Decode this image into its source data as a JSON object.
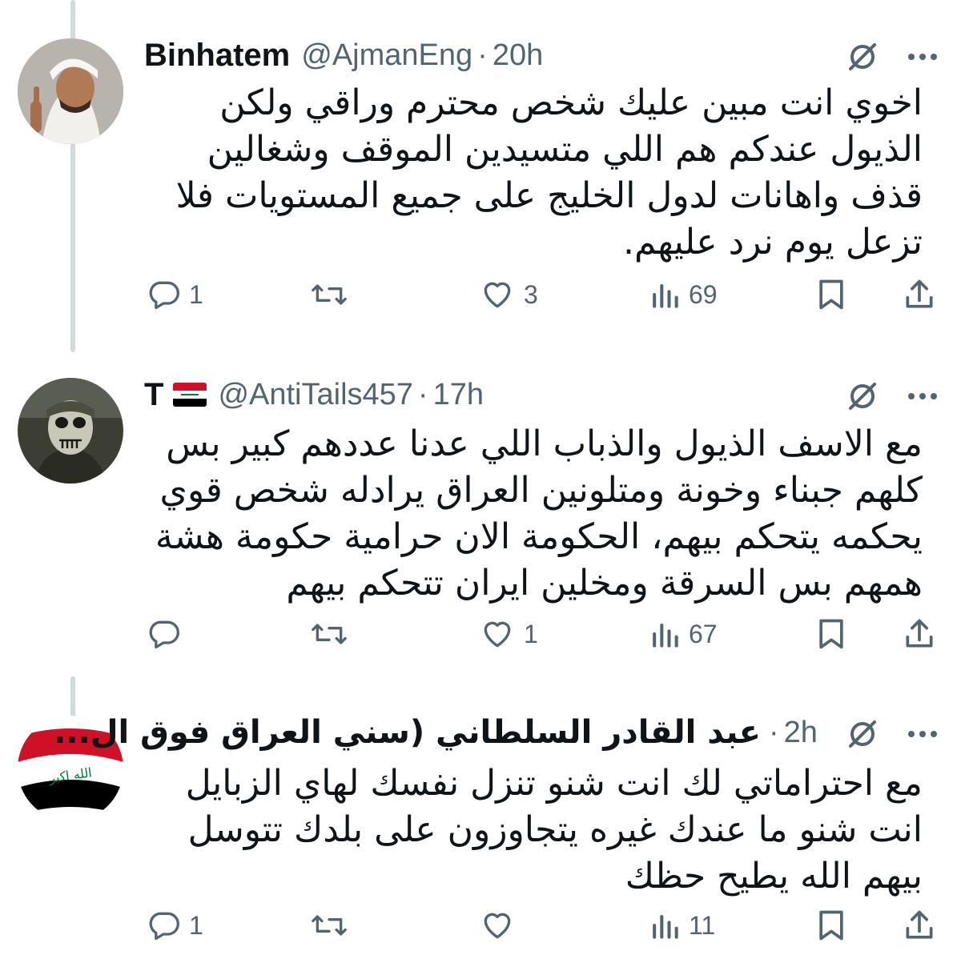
{
  "tweets": [
    {
      "name": "Binhatem",
      "handle": "@AjmanEng",
      "separator": "·",
      "time": "20h",
      "text": "اخوي انت مبين عليك شخص محترم وراقي ولكن الذيول عندكم هم اللي متسيدين الموقف وشغالين قذف واهانات لدول الخليج على جميع المستويات فلا تزعل يوم نرد عليهم.",
      "replies": "1",
      "reposts": "",
      "likes": "3",
      "views": "69"
    },
    {
      "name": "T",
      "handle": "@AntiTails457",
      "separator": "·",
      "time": "17h",
      "text": "مع الاسف الذيول والذباب اللي عدنا عددهم كبير بس كلهم جبناء وخونة ومتلونين العراق يرادله شخص قوي يحكمه يتحكم بيهم، الحكومة الان حرامية حكومة هشة همهم بس السرقة ومخلين ايران تتحكم بيهم",
      "replies": "",
      "reposts": "",
      "likes": "1",
      "views": "67"
    },
    {
      "name": "عبد القادر السلطاني (سني العراق فوق ال...",
      "handle": "",
      "separator": "·",
      "time": "2h",
      "text": "مع احتراماتي لك انت شنو تنزل نفسك لهاي الزبايل انت شنو ما عندك غيره يتجاوزون على بلدك تتوسل بيهم الله يطيح حظك",
      "replies": "1",
      "reposts": "",
      "likes": "",
      "views": "11"
    }
  ],
  "flag_text": "الله اكبر",
  "icons": [
    "reply-icon",
    "repost-icon",
    "like-icon",
    "views-icon",
    "bookmark-icon",
    "share-icon",
    "grok-icon",
    "more-icon"
  ],
  "colors": {
    "text": "#0f1419",
    "secondary": "#536471",
    "thread": "#cfd9de"
  }
}
